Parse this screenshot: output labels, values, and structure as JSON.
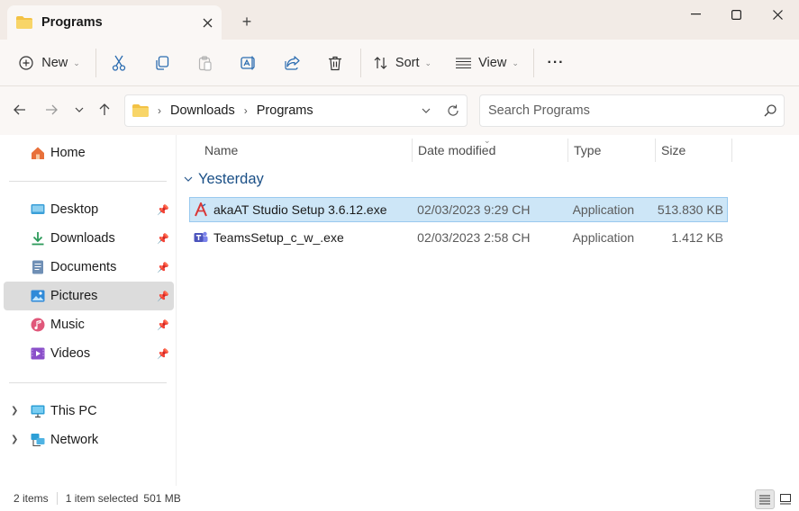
{
  "window": {
    "tab_title": "Programs",
    "new_tab_label": "+"
  },
  "toolbar": {
    "new_label": "New",
    "sort_label": "Sort",
    "view_label": "View",
    "more_label": "···"
  },
  "address": {
    "crumbs": [
      "Downloads",
      "Programs"
    ]
  },
  "search": {
    "placeholder": "Search Programs"
  },
  "sidebar": {
    "home": "Home",
    "quick_access": [
      {
        "label": "Desktop",
        "icon": "desktop-icon",
        "pinned": true
      },
      {
        "label": "Downloads",
        "icon": "download-icon",
        "pinned": true
      },
      {
        "label": "Documents",
        "icon": "documents-icon",
        "pinned": true
      },
      {
        "label": "Pictures",
        "icon": "pictures-icon",
        "pinned": true,
        "selected": true
      },
      {
        "label": "Music",
        "icon": "music-icon",
        "pinned": true
      },
      {
        "label": "Videos",
        "icon": "videos-icon",
        "pinned": true
      }
    ],
    "this_pc": "This PC",
    "network": "Network"
  },
  "columns": {
    "name": "Name",
    "date": "Date modified",
    "type": "Type",
    "size": "Size"
  },
  "group": {
    "label": "Yesterday"
  },
  "files": [
    {
      "name": "akaAT Studio Setup 3.6.12.exe",
      "date": "02/03/2023 9:29 CH",
      "type": "Application",
      "size": "513.830 KB",
      "selected": true,
      "icon": "akaat-app-icon"
    },
    {
      "name": "TeamsSetup_c_w_.exe",
      "date": "02/03/2023 2:58 CH",
      "type": "Application",
      "size": "1.412 KB",
      "selected": false,
      "icon": "teams-app-icon"
    }
  ],
  "status": {
    "items": "2 items",
    "selection": "1 item selected",
    "selection_size": "501 MB"
  },
  "colors": {
    "accent": "#005fb8",
    "selection_bg": "#cde6f7",
    "folder_yellow": "#f3c245",
    "group_header": "#1a4f86"
  }
}
